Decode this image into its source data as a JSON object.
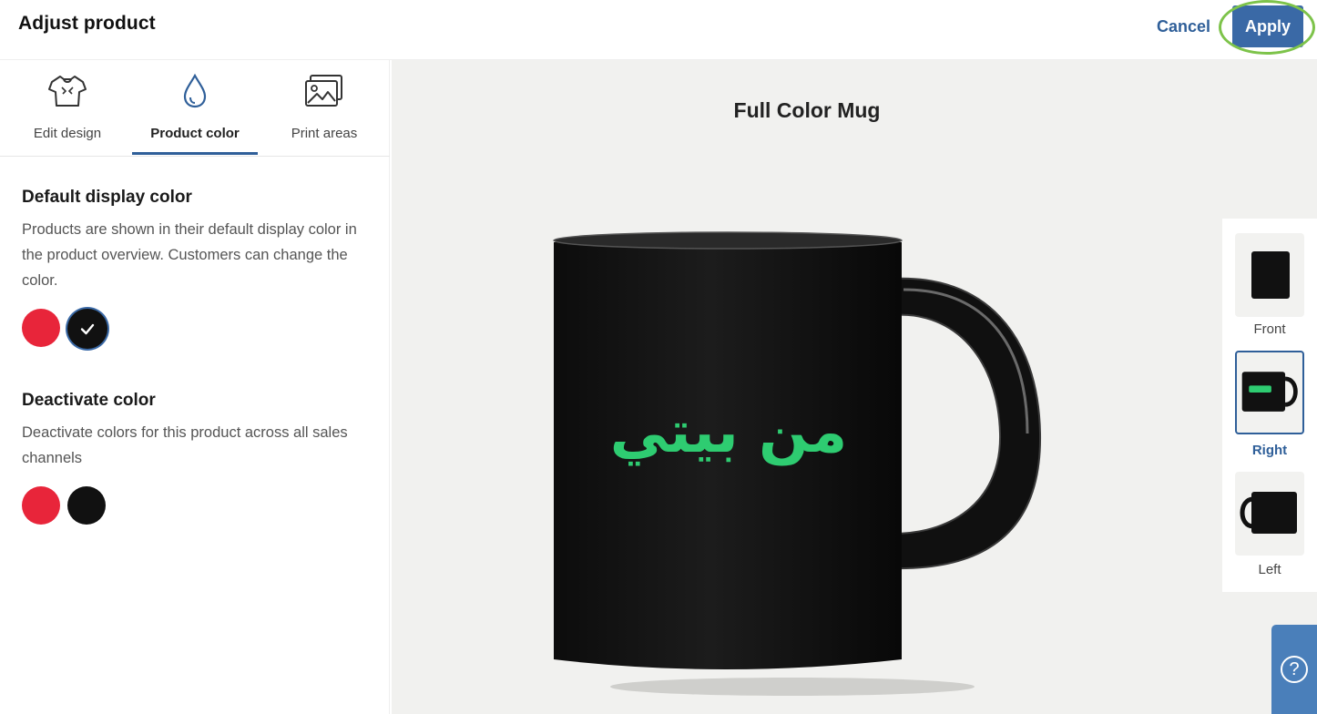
{
  "header": {
    "title": "Adjust product",
    "cancel_label": "Cancel",
    "apply_label": "Apply"
  },
  "tabs": [
    {
      "label": "Edit design",
      "icon": "tshirt-icon",
      "active": false
    },
    {
      "label": "Product color",
      "icon": "drop-icon",
      "active": true
    },
    {
      "label": "Print areas",
      "icon": "images-icon",
      "active": false
    }
  ],
  "default_color": {
    "heading": "Default display color",
    "description": "Products are shown in their default display color in the product overview. Customers can change the color.",
    "swatches": [
      {
        "color": "#e8253a",
        "selected": false
      },
      {
        "color": "#111111",
        "selected": true
      }
    ]
  },
  "deactivate_color": {
    "heading": "Deactivate color",
    "description": "Deactivate colors for this product across all sales channels",
    "swatches": [
      {
        "color": "#e8253a"
      },
      {
        "color": "#111111"
      }
    ]
  },
  "preview": {
    "product_title": "Full Color Mug",
    "mug_text": "من بيتي",
    "mug_text_color": "#2ecc71"
  },
  "views": [
    {
      "label": "Front",
      "selected": false
    },
    {
      "label": "Right",
      "selected": true
    },
    {
      "label": "Left",
      "selected": false
    }
  ],
  "help": {
    "icon": "question-icon",
    "symbol": "?"
  },
  "colors": {
    "accent": "#2f5f99",
    "apply_bg": "#3a69a6",
    "highlight": "#7dc34a"
  }
}
